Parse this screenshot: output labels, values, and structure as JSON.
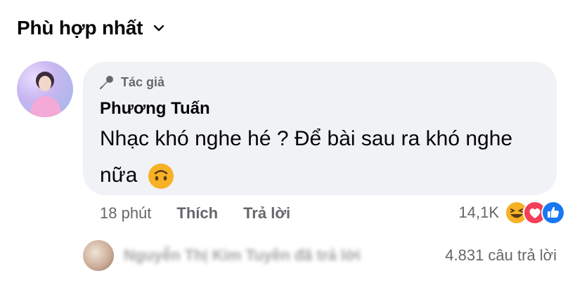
{
  "sort": {
    "label": "Phù hợp nhất"
  },
  "comment": {
    "author_badge": "Tác giả",
    "author_name": "Phương Tuấn",
    "text": "Nhạc khó nghe hé ? Để bài sau ra khó nghe nữa",
    "time": "18 phút",
    "like_label": "Thích",
    "reply_label": "Trả lời",
    "reaction_count": "14,1K",
    "inline_emoji": "upside-down-face",
    "reaction_icons": [
      "laughing-face-icon",
      "heart-icon",
      "like-icon"
    ]
  },
  "replies": {
    "preview_name": "Nguyễn Thị Kim Tuyền đã trả lời",
    "count_label": "4.831 câu trả lời"
  },
  "colors": {
    "bubble": "#f0f2f5",
    "secondary_text": "#65676b",
    "like_blue": "#1877f2",
    "heart_red": "#f33e58",
    "emoji_yellow": "#f7b125"
  }
}
